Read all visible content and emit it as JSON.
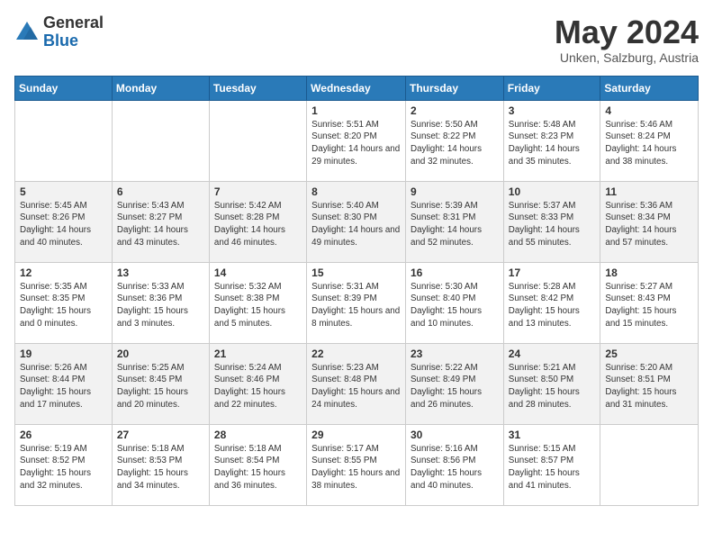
{
  "header": {
    "logo_general": "General",
    "logo_blue": "Blue",
    "month_title": "May 2024",
    "location": "Unken, Salzburg, Austria"
  },
  "weekdays": [
    "Sunday",
    "Monday",
    "Tuesday",
    "Wednesday",
    "Thursday",
    "Friday",
    "Saturday"
  ],
  "weeks": [
    [
      {
        "day": "",
        "info": ""
      },
      {
        "day": "",
        "info": ""
      },
      {
        "day": "",
        "info": ""
      },
      {
        "day": "1",
        "info": "Sunrise: 5:51 AM\nSunset: 8:20 PM\nDaylight: 14 hours and 29 minutes."
      },
      {
        "day": "2",
        "info": "Sunrise: 5:50 AM\nSunset: 8:22 PM\nDaylight: 14 hours and 32 minutes."
      },
      {
        "day": "3",
        "info": "Sunrise: 5:48 AM\nSunset: 8:23 PM\nDaylight: 14 hours and 35 minutes."
      },
      {
        "day": "4",
        "info": "Sunrise: 5:46 AM\nSunset: 8:24 PM\nDaylight: 14 hours and 38 minutes."
      }
    ],
    [
      {
        "day": "5",
        "info": "Sunrise: 5:45 AM\nSunset: 8:26 PM\nDaylight: 14 hours and 40 minutes."
      },
      {
        "day": "6",
        "info": "Sunrise: 5:43 AM\nSunset: 8:27 PM\nDaylight: 14 hours and 43 minutes."
      },
      {
        "day": "7",
        "info": "Sunrise: 5:42 AM\nSunset: 8:28 PM\nDaylight: 14 hours and 46 minutes."
      },
      {
        "day": "8",
        "info": "Sunrise: 5:40 AM\nSunset: 8:30 PM\nDaylight: 14 hours and 49 minutes."
      },
      {
        "day": "9",
        "info": "Sunrise: 5:39 AM\nSunset: 8:31 PM\nDaylight: 14 hours and 52 minutes."
      },
      {
        "day": "10",
        "info": "Sunrise: 5:37 AM\nSunset: 8:33 PM\nDaylight: 14 hours and 55 minutes."
      },
      {
        "day": "11",
        "info": "Sunrise: 5:36 AM\nSunset: 8:34 PM\nDaylight: 14 hours and 57 minutes."
      }
    ],
    [
      {
        "day": "12",
        "info": "Sunrise: 5:35 AM\nSunset: 8:35 PM\nDaylight: 15 hours and 0 minutes."
      },
      {
        "day": "13",
        "info": "Sunrise: 5:33 AM\nSunset: 8:36 PM\nDaylight: 15 hours and 3 minutes."
      },
      {
        "day": "14",
        "info": "Sunrise: 5:32 AM\nSunset: 8:38 PM\nDaylight: 15 hours and 5 minutes."
      },
      {
        "day": "15",
        "info": "Sunrise: 5:31 AM\nSunset: 8:39 PM\nDaylight: 15 hours and 8 minutes."
      },
      {
        "day": "16",
        "info": "Sunrise: 5:30 AM\nSunset: 8:40 PM\nDaylight: 15 hours and 10 minutes."
      },
      {
        "day": "17",
        "info": "Sunrise: 5:28 AM\nSunset: 8:42 PM\nDaylight: 15 hours and 13 minutes."
      },
      {
        "day": "18",
        "info": "Sunrise: 5:27 AM\nSunset: 8:43 PM\nDaylight: 15 hours and 15 minutes."
      }
    ],
    [
      {
        "day": "19",
        "info": "Sunrise: 5:26 AM\nSunset: 8:44 PM\nDaylight: 15 hours and 17 minutes."
      },
      {
        "day": "20",
        "info": "Sunrise: 5:25 AM\nSunset: 8:45 PM\nDaylight: 15 hours and 20 minutes."
      },
      {
        "day": "21",
        "info": "Sunrise: 5:24 AM\nSunset: 8:46 PM\nDaylight: 15 hours and 22 minutes."
      },
      {
        "day": "22",
        "info": "Sunrise: 5:23 AM\nSunset: 8:48 PM\nDaylight: 15 hours and 24 minutes."
      },
      {
        "day": "23",
        "info": "Sunrise: 5:22 AM\nSunset: 8:49 PM\nDaylight: 15 hours and 26 minutes."
      },
      {
        "day": "24",
        "info": "Sunrise: 5:21 AM\nSunset: 8:50 PM\nDaylight: 15 hours and 28 minutes."
      },
      {
        "day": "25",
        "info": "Sunrise: 5:20 AM\nSunset: 8:51 PM\nDaylight: 15 hours and 31 minutes."
      }
    ],
    [
      {
        "day": "26",
        "info": "Sunrise: 5:19 AM\nSunset: 8:52 PM\nDaylight: 15 hours and 32 minutes."
      },
      {
        "day": "27",
        "info": "Sunrise: 5:18 AM\nSunset: 8:53 PM\nDaylight: 15 hours and 34 minutes."
      },
      {
        "day": "28",
        "info": "Sunrise: 5:18 AM\nSunset: 8:54 PM\nDaylight: 15 hours and 36 minutes."
      },
      {
        "day": "29",
        "info": "Sunrise: 5:17 AM\nSunset: 8:55 PM\nDaylight: 15 hours and 38 minutes."
      },
      {
        "day": "30",
        "info": "Sunrise: 5:16 AM\nSunset: 8:56 PM\nDaylight: 15 hours and 40 minutes."
      },
      {
        "day": "31",
        "info": "Sunrise: 5:15 AM\nSunset: 8:57 PM\nDaylight: 15 hours and 41 minutes."
      },
      {
        "day": "",
        "info": ""
      }
    ]
  ]
}
